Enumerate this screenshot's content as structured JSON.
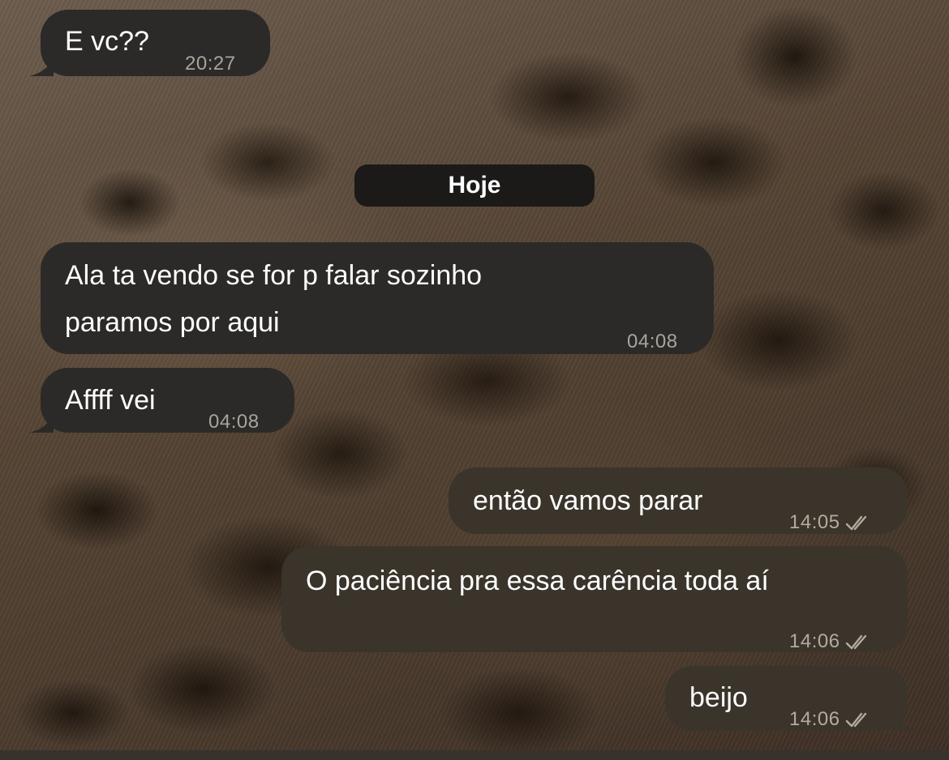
{
  "date_separator": "Hoje",
  "messages": [
    {
      "direction": "incoming",
      "text_lines": [
        "E vc??"
      ],
      "time": "20:27"
    },
    {
      "direction": "incoming",
      "text_lines": [
        "Ala ta vendo se for p falar sozinho",
        "paramos por aqui"
      ],
      "time": "04:08"
    },
    {
      "direction": "incoming",
      "text_lines": [
        "Affff vei"
      ],
      "time": "04:08"
    },
    {
      "direction": "outgoing",
      "text_lines": [
        "então vamos parar"
      ],
      "time": "14:05",
      "status": "read-double-check-icon"
    },
    {
      "direction": "outgoing",
      "text_lines": [
        "O paciência pra essa carência toda aí"
      ],
      "time": "14:06",
      "status": "read-double-check-icon"
    },
    {
      "direction": "outgoing",
      "text_lines": [
        "beijo"
      ],
      "time": "14:06",
      "status": "read-double-check-icon"
    }
  ],
  "colors": {
    "incoming_bubble": "#2b2a28",
    "outgoing_bubble": "#3b342b",
    "date_pill": "#1b1a19",
    "text": "#ffffff",
    "timestamp": "#a8a49c"
  }
}
